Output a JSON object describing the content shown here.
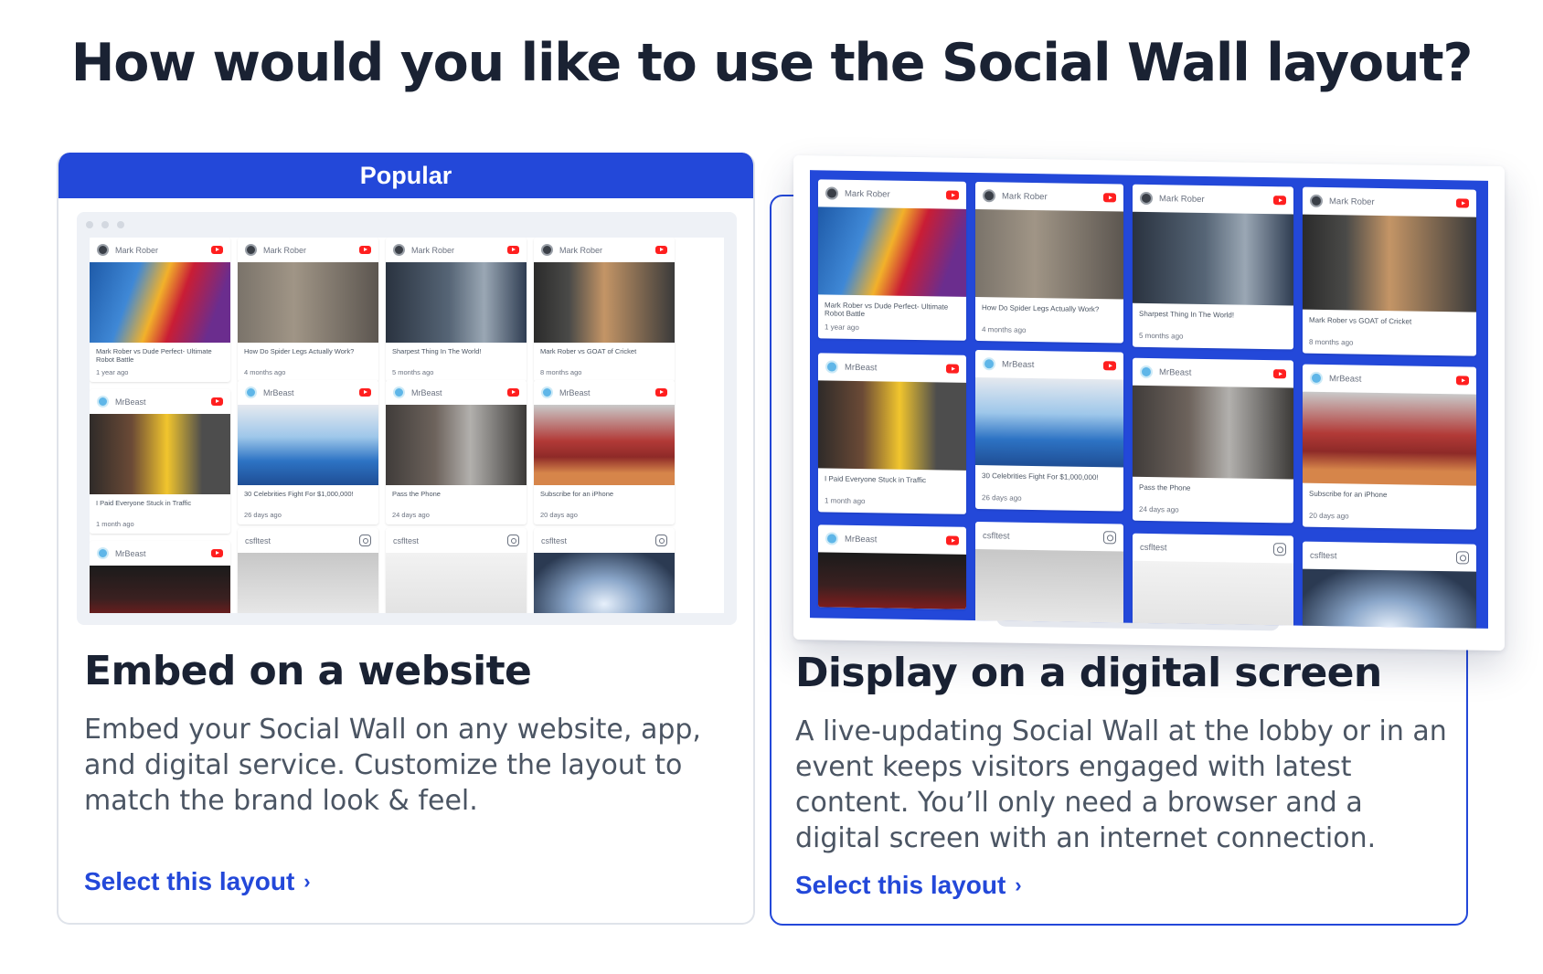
{
  "page": {
    "title": "How would you like to use the Social Wall layout?"
  },
  "colors": {
    "accent": "#2348d9",
    "heading": "#1a2233",
    "body": "#4b5563",
    "youtube_red": "#ff1f1f"
  },
  "website_option": {
    "badge": "Popular",
    "heading": "Embed on a website",
    "description": "Embed your Social Wall on any website, app, and digital service. Customize the layout to match the brand look & feel.",
    "cta": "Select this layout",
    "cta_icon": "chevron-right-icon"
  },
  "screen_option": {
    "heading": "Display on a digital screen",
    "description": "A live-updating Social Wall at the lobby or in an event keeps visitors engaged with latest content. You’ll only need a browser and a digital screen with an internet connection.",
    "cta": "Select this layout",
    "cta_icon": "chevron-right-icon"
  },
  "posts": [
    {
      "author": "Mark Rober",
      "network": "youtube",
      "title": "Mark Rober vs Dude Perfect- Ultimate Robot Battle",
      "time": "1 year ago"
    },
    {
      "author": "Mark Rober",
      "network": "youtube",
      "title": "How Do Spider Legs Actually Work?",
      "time": "4 months ago"
    },
    {
      "author": "Mark Rober",
      "network": "youtube",
      "title": "Sharpest Thing In The World!",
      "time": "5 months ago"
    },
    {
      "author": "Mark Rober",
      "network": "youtube",
      "title": "Mark Rober vs GOAT of Cricket",
      "time": "8 months ago"
    },
    {
      "author": "MrBeast",
      "network": "youtube",
      "title": "I Paid Everyone Stuck in Traffic",
      "time": "1 month ago"
    },
    {
      "author": "MrBeast",
      "network": "youtube",
      "title": "30 Celebrities Fight For $1,000,000!",
      "time": "26 days ago"
    },
    {
      "author": "MrBeast",
      "network": "youtube",
      "title": "Pass the Phone",
      "time": "24 days ago"
    },
    {
      "author": "MrBeast",
      "network": "youtube",
      "title": "Subscribe for an iPhone",
      "time": "20 days ago"
    },
    {
      "author": "MrBeast",
      "network": "youtube"
    },
    {
      "author": "csfltest",
      "network": "instagram"
    },
    {
      "author": "csfltest",
      "network": "instagram"
    },
    {
      "author": "csfltest",
      "network": "instagram"
    }
  ]
}
